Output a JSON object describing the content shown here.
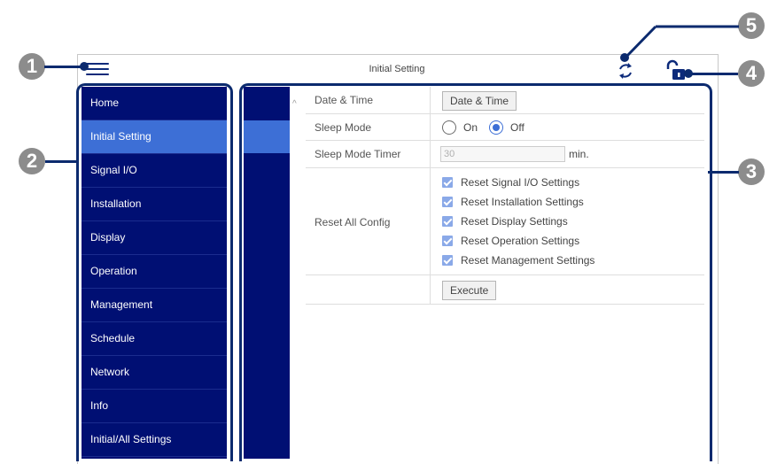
{
  "header": {
    "title": "Initial Setting"
  },
  "sidebar": {
    "items": [
      {
        "label": "Home"
      },
      {
        "label": "Initial Setting"
      },
      {
        "label": "Signal I/O"
      },
      {
        "label": "Installation"
      },
      {
        "label": "Display"
      },
      {
        "label": "Operation"
      },
      {
        "label": "Management"
      },
      {
        "label": "Schedule"
      },
      {
        "label": "Network"
      },
      {
        "label": "Info"
      },
      {
        "label": "Initial/All Settings"
      }
    ],
    "active": "Initial Setting"
  },
  "settings": {
    "date_time": {
      "label": "Date & Time",
      "button": "Date & Time"
    },
    "sleep_mode": {
      "label": "Sleep Mode",
      "options": [
        "On",
        "Off"
      ],
      "selected": "Off"
    },
    "sleep_timer": {
      "label": "Sleep Mode Timer",
      "value": "30",
      "unit": "min."
    },
    "reset_all": {
      "label": "Reset All Config",
      "options": [
        "Reset Signal I/O Settings",
        "Reset Installation Settings",
        "Reset Display Settings",
        "Reset Operation Settings",
        "Reset Management Settings"
      ],
      "execute": "Execute"
    }
  },
  "callouts": [
    "1",
    "2",
    "3",
    "4",
    "5"
  ],
  "colors": {
    "nav_bg": "#000f73",
    "nav_active": "#3d6fd6",
    "accent": "#0b2a6e",
    "callout": "#8c8c8c"
  },
  "icons": {
    "menu": "hamburger-icon",
    "refresh": "refresh-icon",
    "lock": "unlock-icon"
  }
}
